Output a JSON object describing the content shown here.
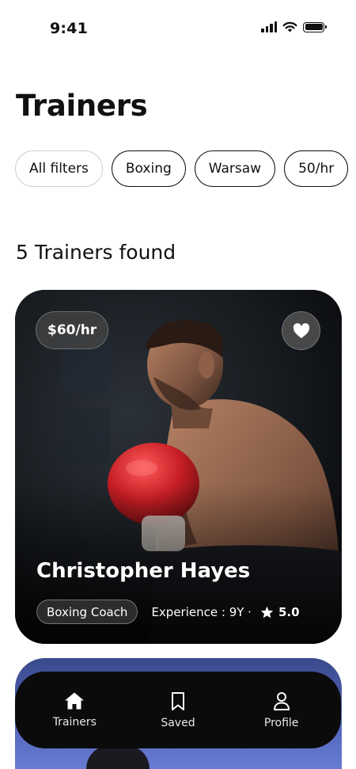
{
  "status_bar": {
    "time": "9:41"
  },
  "page": {
    "title": "Trainers",
    "results_count": "5 Trainers found"
  },
  "filters": [
    "All filters",
    "Boxing",
    "Warsaw",
    "50/hr"
  ],
  "trainer_card": {
    "price": "$60/hr",
    "name": "Christopher Hayes",
    "role": "Boxing Coach",
    "experience": "Experience : 9Y ·",
    "rating": "5.0"
  },
  "bottom_nav": {
    "items": [
      {
        "label": "Trainers",
        "icon": "home-icon"
      },
      {
        "label": "Saved",
        "icon": "bookmark-icon"
      },
      {
        "label": "Profile",
        "icon": "user-icon"
      }
    ]
  },
  "colors": {
    "background": "#ffffff",
    "text": "#111111",
    "card_dark": "#141414",
    "nav_bg": "#0b0b0b",
    "glove_red": "#d42a2a"
  }
}
